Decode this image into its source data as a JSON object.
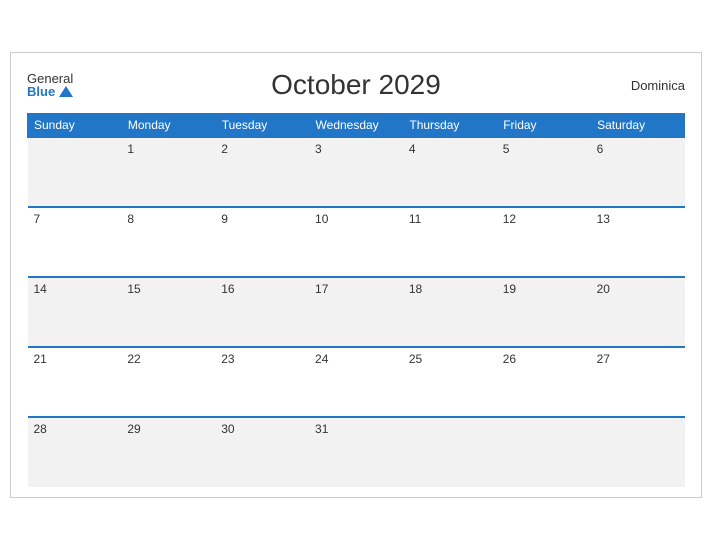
{
  "header": {
    "logo_general": "General",
    "logo_blue": "Blue",
    "title": "October 2029",
    "country": "Dominica"
  },
  "weekdays": [
    "Sunday",
    "Monday",
    "Tuesday",
    "Wednesday",
    "Thursday",
    "Friday",
    "Saturday"
  ],
  "weeks": [
    [
      "",
      "1",
      "2",
      "3",
      "4",
      "5",
      "6"
    ],
    [
      "7",
      "8",
      "9",
      "10",
      "11",
      "12",
      "13"
    ],
    [
      "14",
      "15",
      "16",
      "17",
      "18",
      "19",
      "20"
    ],
    [
      "21",
      "22",
      "23",
      "24",
      "25",
      "26",
      "27"
    ],
    [
      "28",
      "29",
      "30",
      "31",
      "",
      "",
      ""
    ]
  ]
}
